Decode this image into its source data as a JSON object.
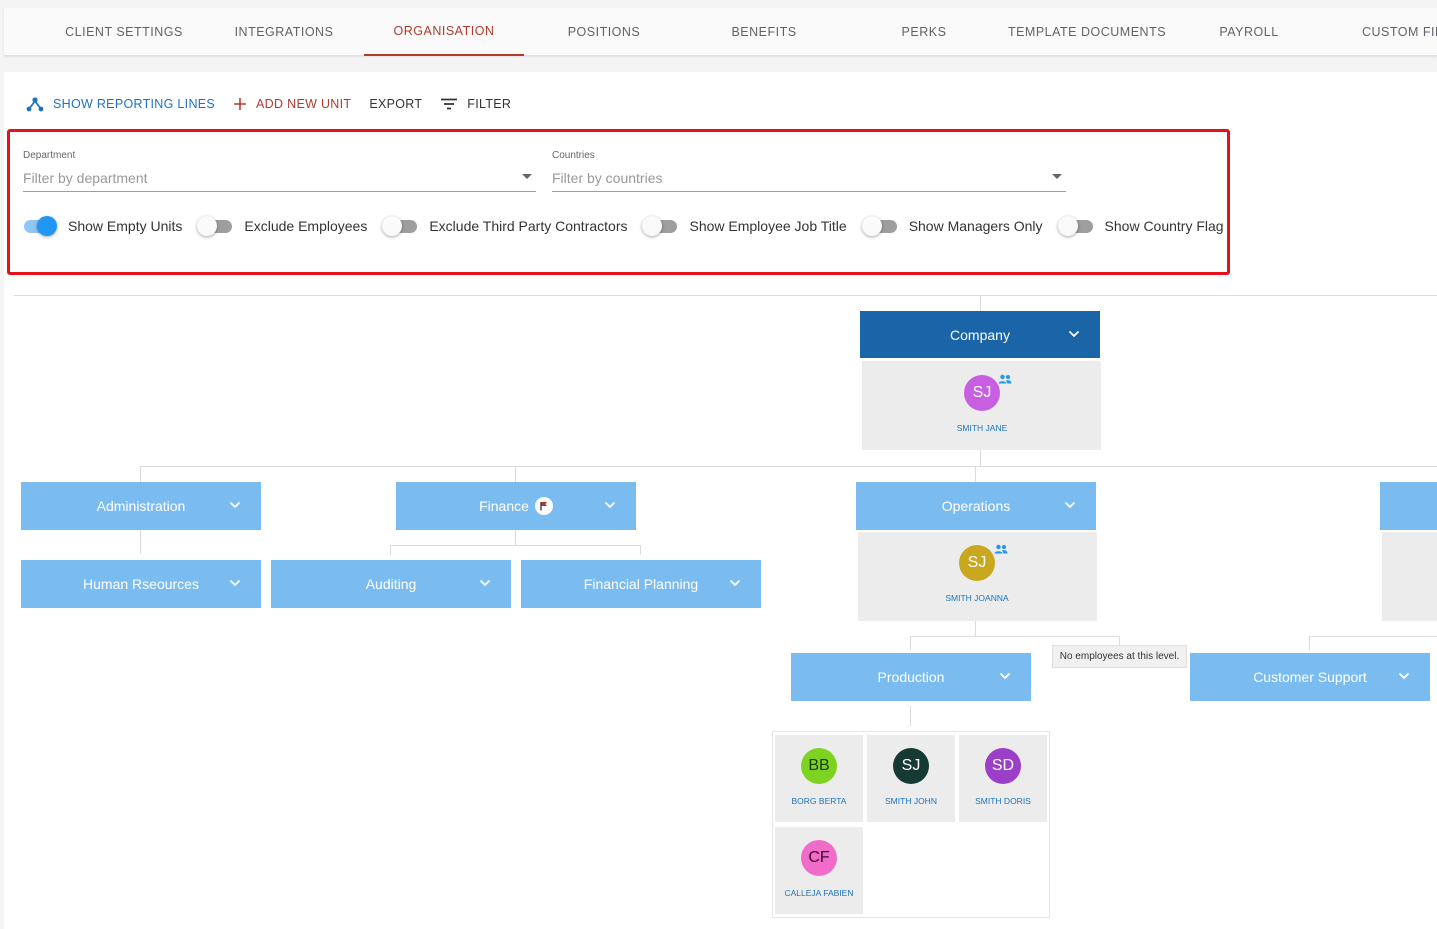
{
  "tabs": [
    {
      "label": "CLIENT SETTINGS"
    },
    {
      "label": "INTEGRATIONS"
    },
    {
      "label": "ORGANISATION"
    },
    {
      "label": "POSITIONS"
    },
    {
      "label": "BENEFITS"
    },
    {
      "label": "PERKS"
    },
    {
      "label": "TEMPLATE DOCUMENTS"
    },
    {
      "label": "PAYROLL"
    },
    {
      "label": "CUSTOM FIEL"
    }
  ],
  "toolbar": {
    "show_reporting_lines": "SHOW REPORTING LINES",
    "add_new_unit": "ADD NEW UNIT",
    "export": "EXPORT",
    "filter": "FILTER"
  },
  "filters": {
    "department": {
      "label": "Department",
      "placeholder": "Filter by department"
    },
    "countries": {
      "label": "Countries",
      "placeholder": "Filter by countries"
    }
  },
  "toggles": [
    {
      "label": "Show Empty Units",
      "on": true
    },
    {
      "label": "Exclude Employees",
      "on": false
    },
    {
      "label": "Exclude Third Party Contractors",
      "on": false
    },
    {
      "label": "Show Employee Job Title",
      "on": false
    },
    {
      "label": "Show Managers Only",
      "on": false
    },
    {
      "label": "Show Country Flag",
      "on": false
    }
  ],
  "org": {
    "company": {
      "name": "Company",
      "manager": {
        "initials": "SJ",
        "name": "SMITH JANE",
        "color": "#c75fe0"
      }
    },
    "administration": {
      "name": "Administration"
    },
    "finance": {
      "name": "Finance"
    },
    "operations": {
      "name": "Operations",
      "manager": {
        "initials": "SJ",
        "name": "SMITH JOANNA",
        "color": "#c9a820"
      }
    },
    "human_resources": {
      "name": "Human Rseources"
    },
    "auditing": {
      "name": "Auditing"
    },
    "financial_planning": {
      "name": "Financial Planning"
    },
    "production": {
      "name": "Production",
      "employees": [
        {
          "initials": "BB",
          "name": "BORG BERTA",
          "color": "#7ed321"
        },
        {
          "initials": "SJ",
          "name": "SMITH JOHN",
          "color": "#163a33"
        },
        {
          "initials": "SD",
          "name": "SMITH DORIS",
          "color": "#9b3fc9"
        },
        {
          "initials": "CF",
          "name": "CALLEJA FABIEN",
          "color": "#f06cc8"
        }
      ]
    },
    "customer_support": {
      "name": "Customer Support"
    },
    "no_employees_tooltip": "No employees at this level."
  },
  "colors": {
    "accent_red": "#b23b2e",
    "accent_blue": "#1e73be",
    "unit_light": "#7bbcf0",
    "unit_dark": "#1a64a8",
    "highlight_border": "#e5101c"
  }
}
